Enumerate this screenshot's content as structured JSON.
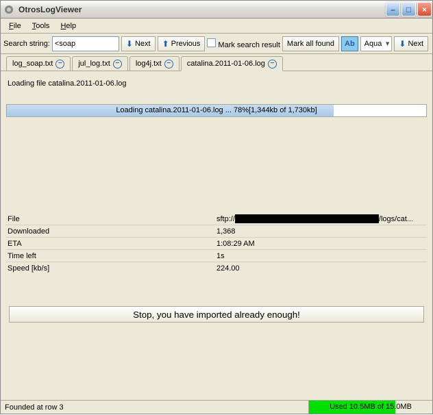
{
  "title": "OtrosLogViewer",
  "menu": {
    "file": "File",
    "tools": "Tools",
    "help": "Help"
  },
  "toolbar": {
    "search_label": "Search string:",
    "search_value": "<soap",
    "next": "Next",
    "previous": "Previous",
    "mark_search": "Mark search result",
    "mark_all": "Mark all found",
    "ab": "Ab",
    "aqua": "Aqua",
    "next2": "Next"
  },
  "tabs": [
    {
      "label": "log_soap.txt",
      "active": false
    },
    {
      "label": "jul_log.txt",
      "active": false
    },
    {
      "label": "log4j.txt",
      "active": false
    },
    {
      "label": "catalina.2011-01-06.log",
      "active": true
    }
  ],
  "loading_label": "Loading file catalina.2011-01-06.log",
  "progress_text": "Loading catalina.2011-01-06.log ... 78%[1,344kb of 1,730kb]",
  "progress_percent": 78,
  "info": {
    "file_label": "File",
    "file_prefix": "sftp://",
    "file_suffix": "/logs/cat...",
    "downloaded_label": "Downloaded",
    "downloaded_value": "1,368",
    "eta_label": "ETA",
    "eta_value": "1:08:29 AM",
    "timeleft_label": "Time left",
    "timeleft_value": "1s",
    "speed_label": "Speed [kb/s]",
    "speed_value": "224.00"
  },
  "stop_button": "Stop, you have imported already enough!",
  "status": {
    "left": "Founded at row 3",
    "right": "Used 10.5MB of 15.0MB"
  }
}
